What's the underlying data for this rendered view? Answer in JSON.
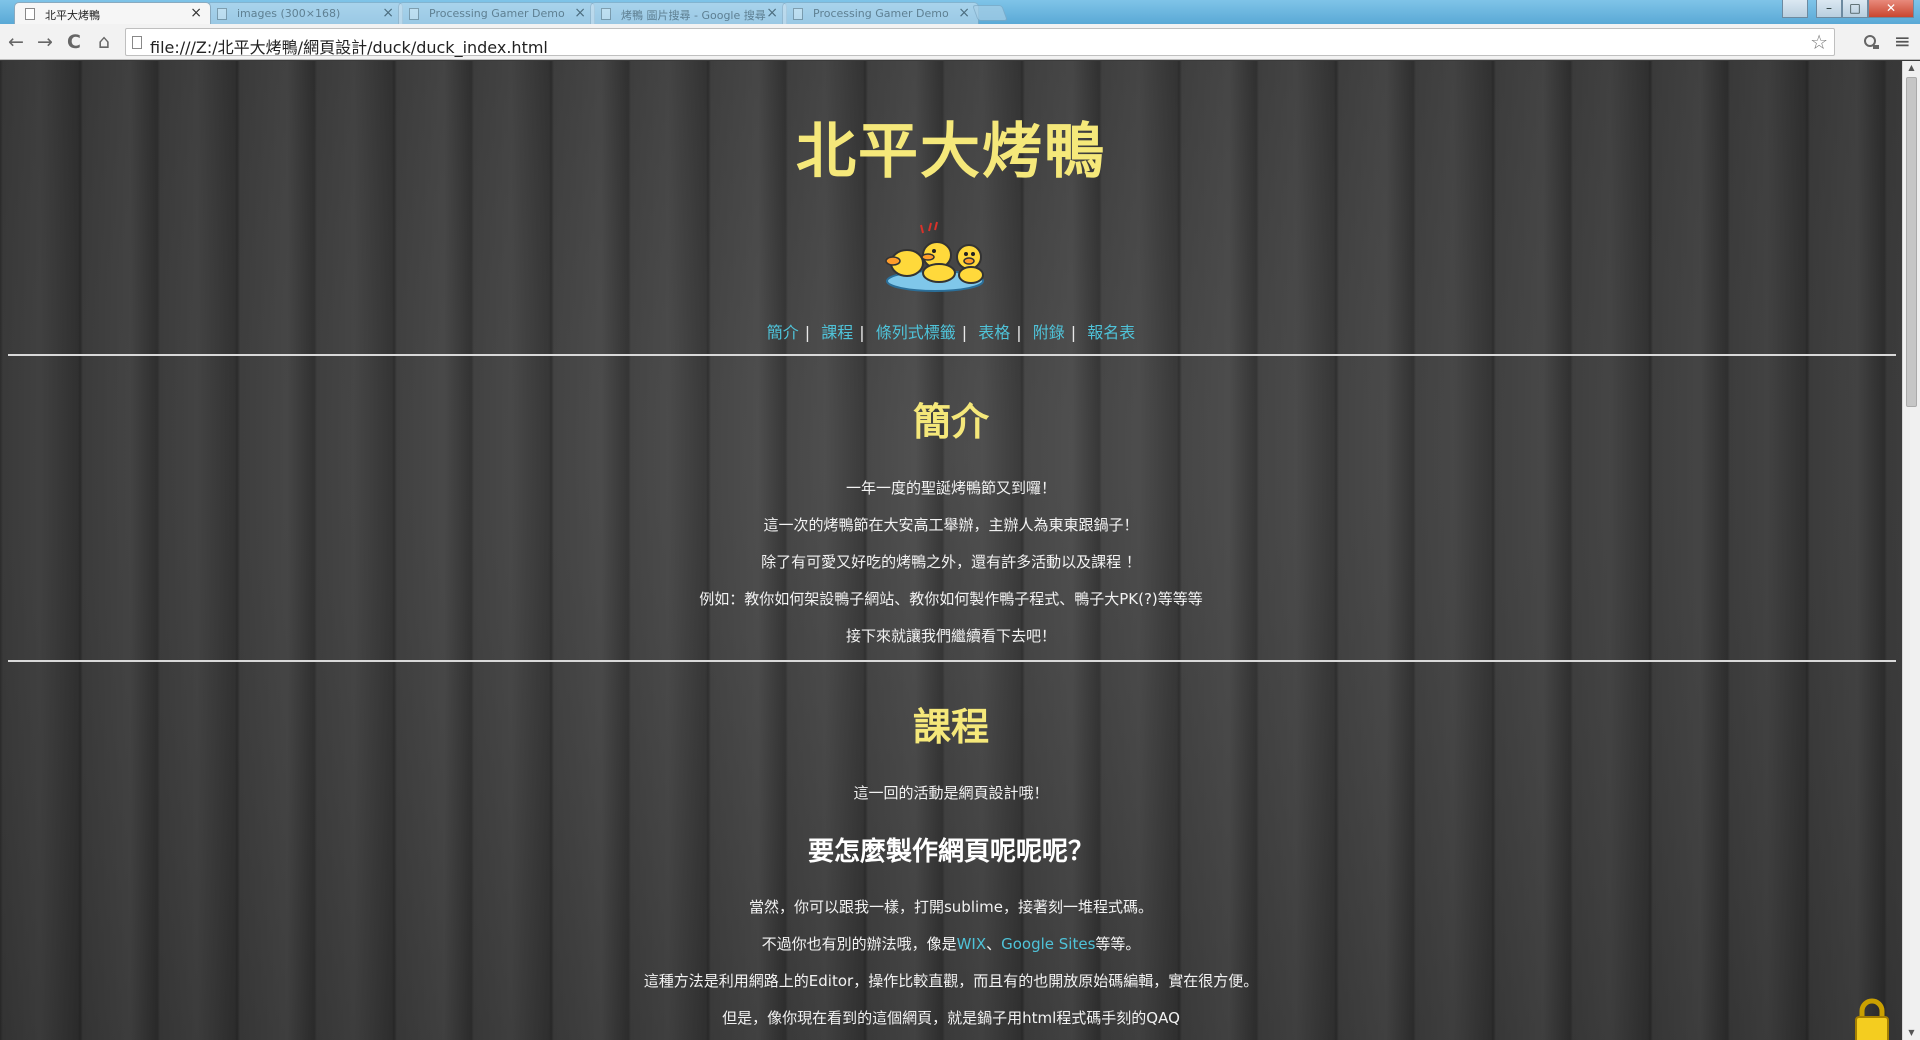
{
  "browser": {
    "tabs": [
      {
        "label": "北平大烤鴨",
        "active": true
      },
      {
        "label": "images (300×168)",
        "active": false
      },
      {
        "label": "Processing Gamer Demo",
        "active": false
      },
      {
        "label": "烤鴨 圖片搜尋 - Google 搜尋",
        "active": false
      },
      {
        "label": "Processing Gamer Demo",
        "active": false
      }
    ],
    "tab_close": "×",
    "url": "file:///Z:/北平大烤鴨/網頁設計/duck/duck_index.html",
    "back": "←",
    "forward": "→",
    "reload": "C",
    "home": "⌂",
    "star": "☆",
    "menu": "≡",
    "window_controls": {
      "minimize": "–",
      "maximize": "□",
      "close": "✕"
    }
  },
  "page": {
    "title": "北平大烤鴨",
    "nav": {
      "items": [
        "簡介",
        "課程",
        "條列式標籤",
        "表格",
        "附錄",
        "報名表"
      ],
      "separator": "|"
    },
    "intro": {
      "heading": "簡介",
      "lines": [
        "一年一度的聖誕烤鴨節又到囉！",
        "這一次的烤鴨節在大安高工舉辦，主辦人為東東跟鍋子！",
        "除了有可愛又好吃的烤鴨之外，還有許多活動以及課程 ！",
        "例如：教你如何架設鴨子網站、教你如何製作鴨子程式、鴨子大PK(?)等等等",
        "接下來就讓我們繼續看下去吧！"
      ]
    },
    "course": {
      "heading": "課程",
      "line1": "這一回的活動是網頁設計哦！",
      "subheading": "要怎麼製作網頁呢呢呢？",
      "line2": "當然，你可以跟我一樣，打開sublime，接著刻一堆程式碼。",
      "line3_pre": "不過你也有別的辦法哦，像是",
      "link_wix": "WIX",
      "line3_sep": "、",
      "link_google_sites": "Google Sites",
      "line3_post": "等等。",
      "line4": "這種方法是利用網路上的Editor，操作比較直觀，而且有的也開放原始碼編輯，實在很方便。",
      "line5": "但是，像你現在看到的這個網頁，就是鍋子用html程式碼手刻的QAQ"
    }
  },
  "colors": {
    "title_yellow": "#f5e87a",
    "link_cyan": "#4fc3d9",
    "background": "#3a3a3a"
  },
  "icons": [
    "page-icon",
    "back-arrow-icon",
    "forward-arrow-icon",
    "reload-icon",
    "home-icon",
    "bookmark-star-icon",
    "extension-icon",
    "menu-icon",
    "duck-logo-icon",
    "lock-icon"
  ]
}
